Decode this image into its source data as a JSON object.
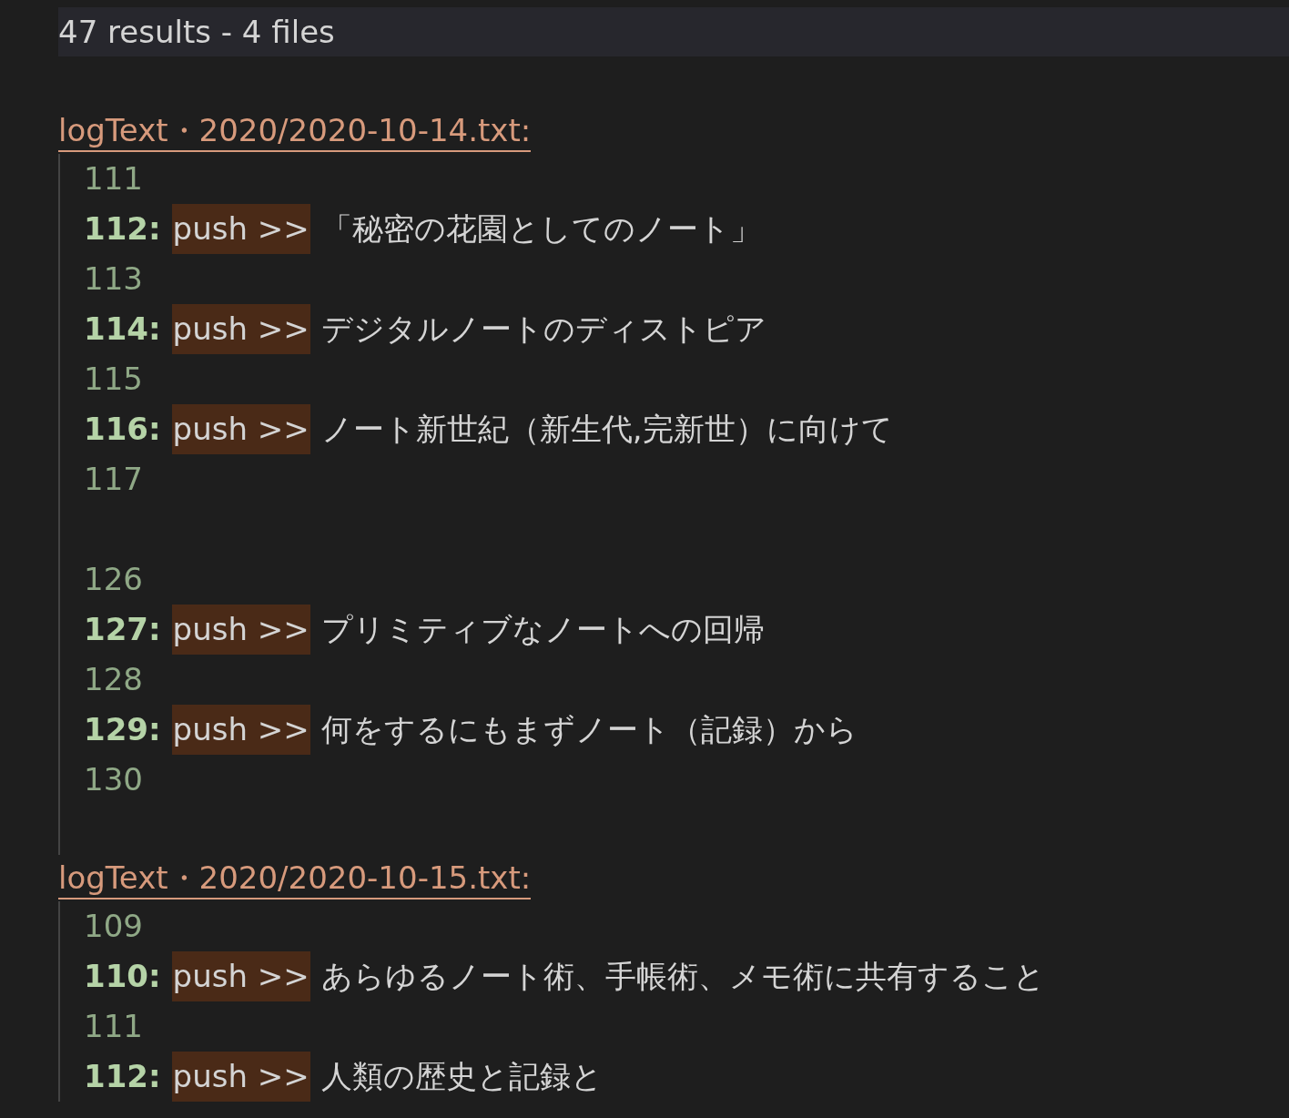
{
  "summary": "47 results - 4 files",
  "files": [
    {
      "header": "logText・2020/2020-10-14.txt:",
      "lines": [
        {
          "kind": "context",
          "number": "111"
        },
        {
          "kind": "match",
          "number": "112:",
          "match": "push >>",
          "text": "「秘密の花園としてのノート」"
        },
        {
          "kind": "context",
          "number": "113"
        },
        {
          "kind": "match",
          "number": "114:",
          "match": "push >>",
          "text": "デジタルノートのディストピア"
        },
        {
          "kind": "context",
          "number": "115"
        },
        {
          "kind": "match",
          "number": "116:",
          "match": "push >>",
          "text": "ノート新世紀（新生代,完新世）に向けて"
        },
        {
          "kind": "context",
          "number": "117"
        },
        {
          "kind": "gap"
        },
        {
          "kind": "context",
          "number": "126"
        },
        {
          "kind": "match",
          "number": "127:",
          "match": "push >>",
          "text": "プリミティブなノートへの回帰"
        },
        {
          "kind": "context",
          "number": "128"
        },
        {
          "kind": "match",
          "number": "129:",
          "match": "push >>",
          "text": "何をするにもまずノート（記録）から"
        },
        {
          "kind": "context",
          "number": "130"
        }
      ]
    },
    {
      "header": "logText・2020/2020-10-15.txt:",
      "lines": [
        {
          "kind": "context",
          "number": "109"
        },
        {
          "kind": "match",
          "number": "110:",
          "match": "push >>",
          "text": "あらゆるノート術、手帳術、メモ術に共有すること"
        },
        {
          "kind": "context",
          "number": "111"
        },
        {
          "kind": "match",
          "number": "112:",
          "match": "push >>",
          "text": "人類の歴史と記録と"
        }
      ]
    }
  ]
}
